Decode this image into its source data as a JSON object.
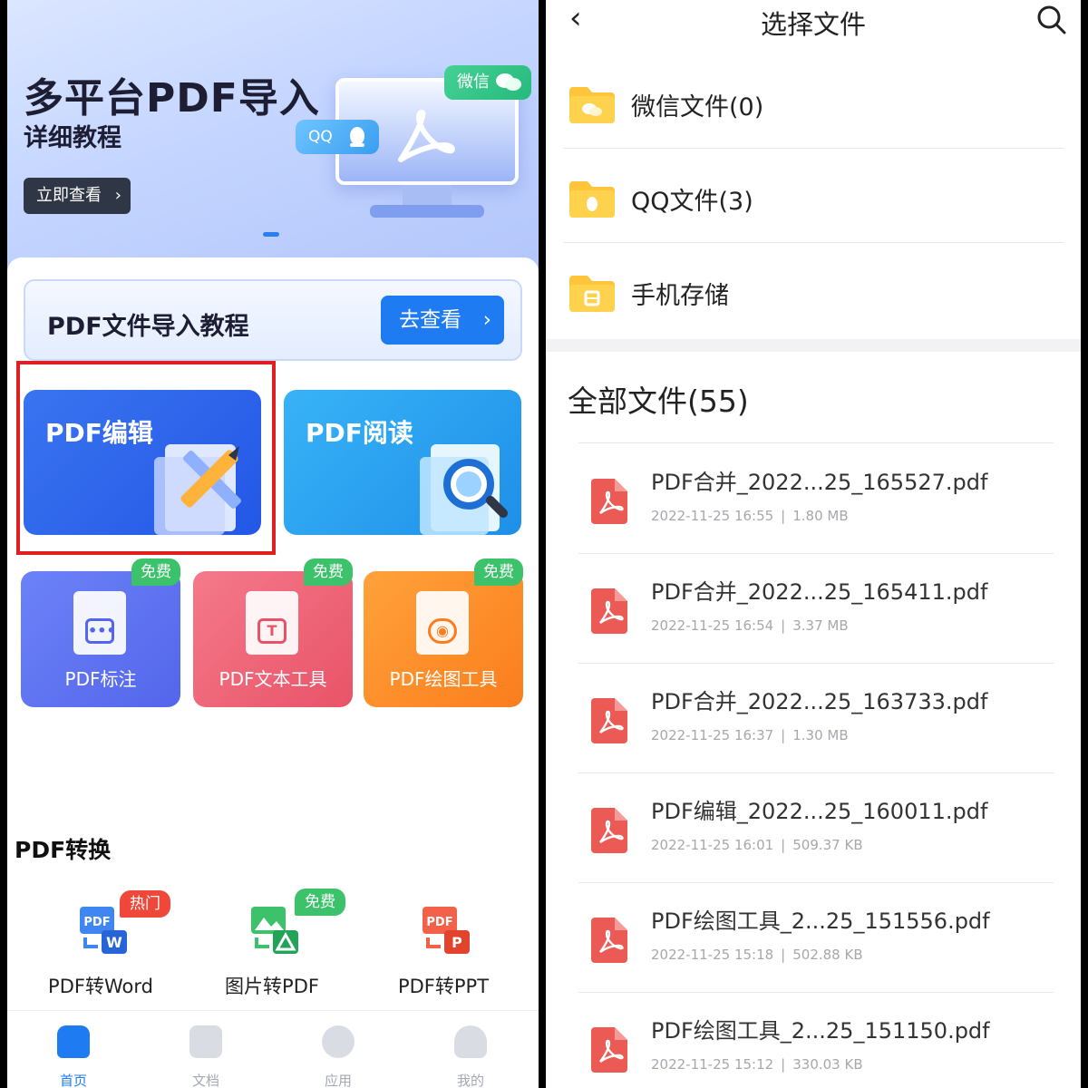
{
  "left": {
    "banner": {
      "title": "多平台PDF导入",
      "subtitle": "详细教程",
      "button_label": "立即查看",
      "bubble_wechat": "微信",
      "bubble_qq": "QQ"
    },
    "tutorial": {
      "label": "PDF文件导入教程",
      "button_label": "去查看"
    },
    "cards": {
      "edit": "PDF编辑",
      "read": "PDF阅读"
    },
    "tools": [
      {
        "label": "PDF标注",
        "badge": "免费"
      },
      {
        "label": "PDF文本工具",
        "badge": "免费"
      },
      {
        "label": "PDF绘图工具",
        "badge": "免费"
      }
    ],
    "convert_section": "PDF转换",
    "convert": [
      {
        "label": "PDF转Word",
        "badge": "热门",
        "icon_text": "PDF",
        "icon_sub": "W"
      },
      {
        "label": "图片转PDF",
        "badge": "免费"
      },
      {
        "label": "PDF转PPT",
        "icon_text": "PDF",
        "icon_sub": "P"
      }
    ],
    "tabs": [
      {
        "label": "首页",
        "icon": "home-icon",
        "active": true
      },
      {
        "label": "文档",
        "icon": "document-icon"
      },
      {
        "label": "应用",
        "icon": "apps-icon"
      },
      {
        "label": "我的",
        "icon": "profile-icon"
      }
    ],
    "colors": {
      "accent": "#1e7bf2",
      "highlight": "#e02020"
    }
  },
  "right": {
    "title": "选择文件",
    "folders": [
      {
        "label": "微信文件(0)",
        "icon": "wechat-folder-icon"
      },
      {
        "label": "QQ文件(3)",
        "icon": "qq-folder-icon"
      },
      {
        "label": "手机存储",
        "icon": "storage-folder-icon"
      }
    ],
    "all_files_title": "全部文件(55)",
    "files": [
      {
        "name": "PDF合并_2022...25_165527.pdf",
        "date": "2022-11-25 16:55",
        "size": "1.80 MB"
      },
      {
        "name": "PDF合并_2022...25_165411.pdf",
        "date": "2022-11-25 16:54",
        "size": "3.37 MB"
      },
      {
        "name": "PDF合并_2022...25_163733.pdf",
        "date": "2022-11-25 16:37",
        "size": "1.30 MB"
      },
      {
        "name": "PDF编辑_2022...25_160011.pdf",
        "date": "2022-11-25 16:01",
        "size": "509.37 KB"
      },
      {
        "name": "PDF绘图工具_2...25_151556.pdf",
        "date": "2022-11-25 15:18",
        "size": "502.88 KB"
      },
      {
        "name": "PDF绘图工具_2...25_151150.pdf",
        "date": "2022-11-25 15:12",
        "size": "330.03 KB"
      }
    ],
    "meta_separator": "|"
  }
}
